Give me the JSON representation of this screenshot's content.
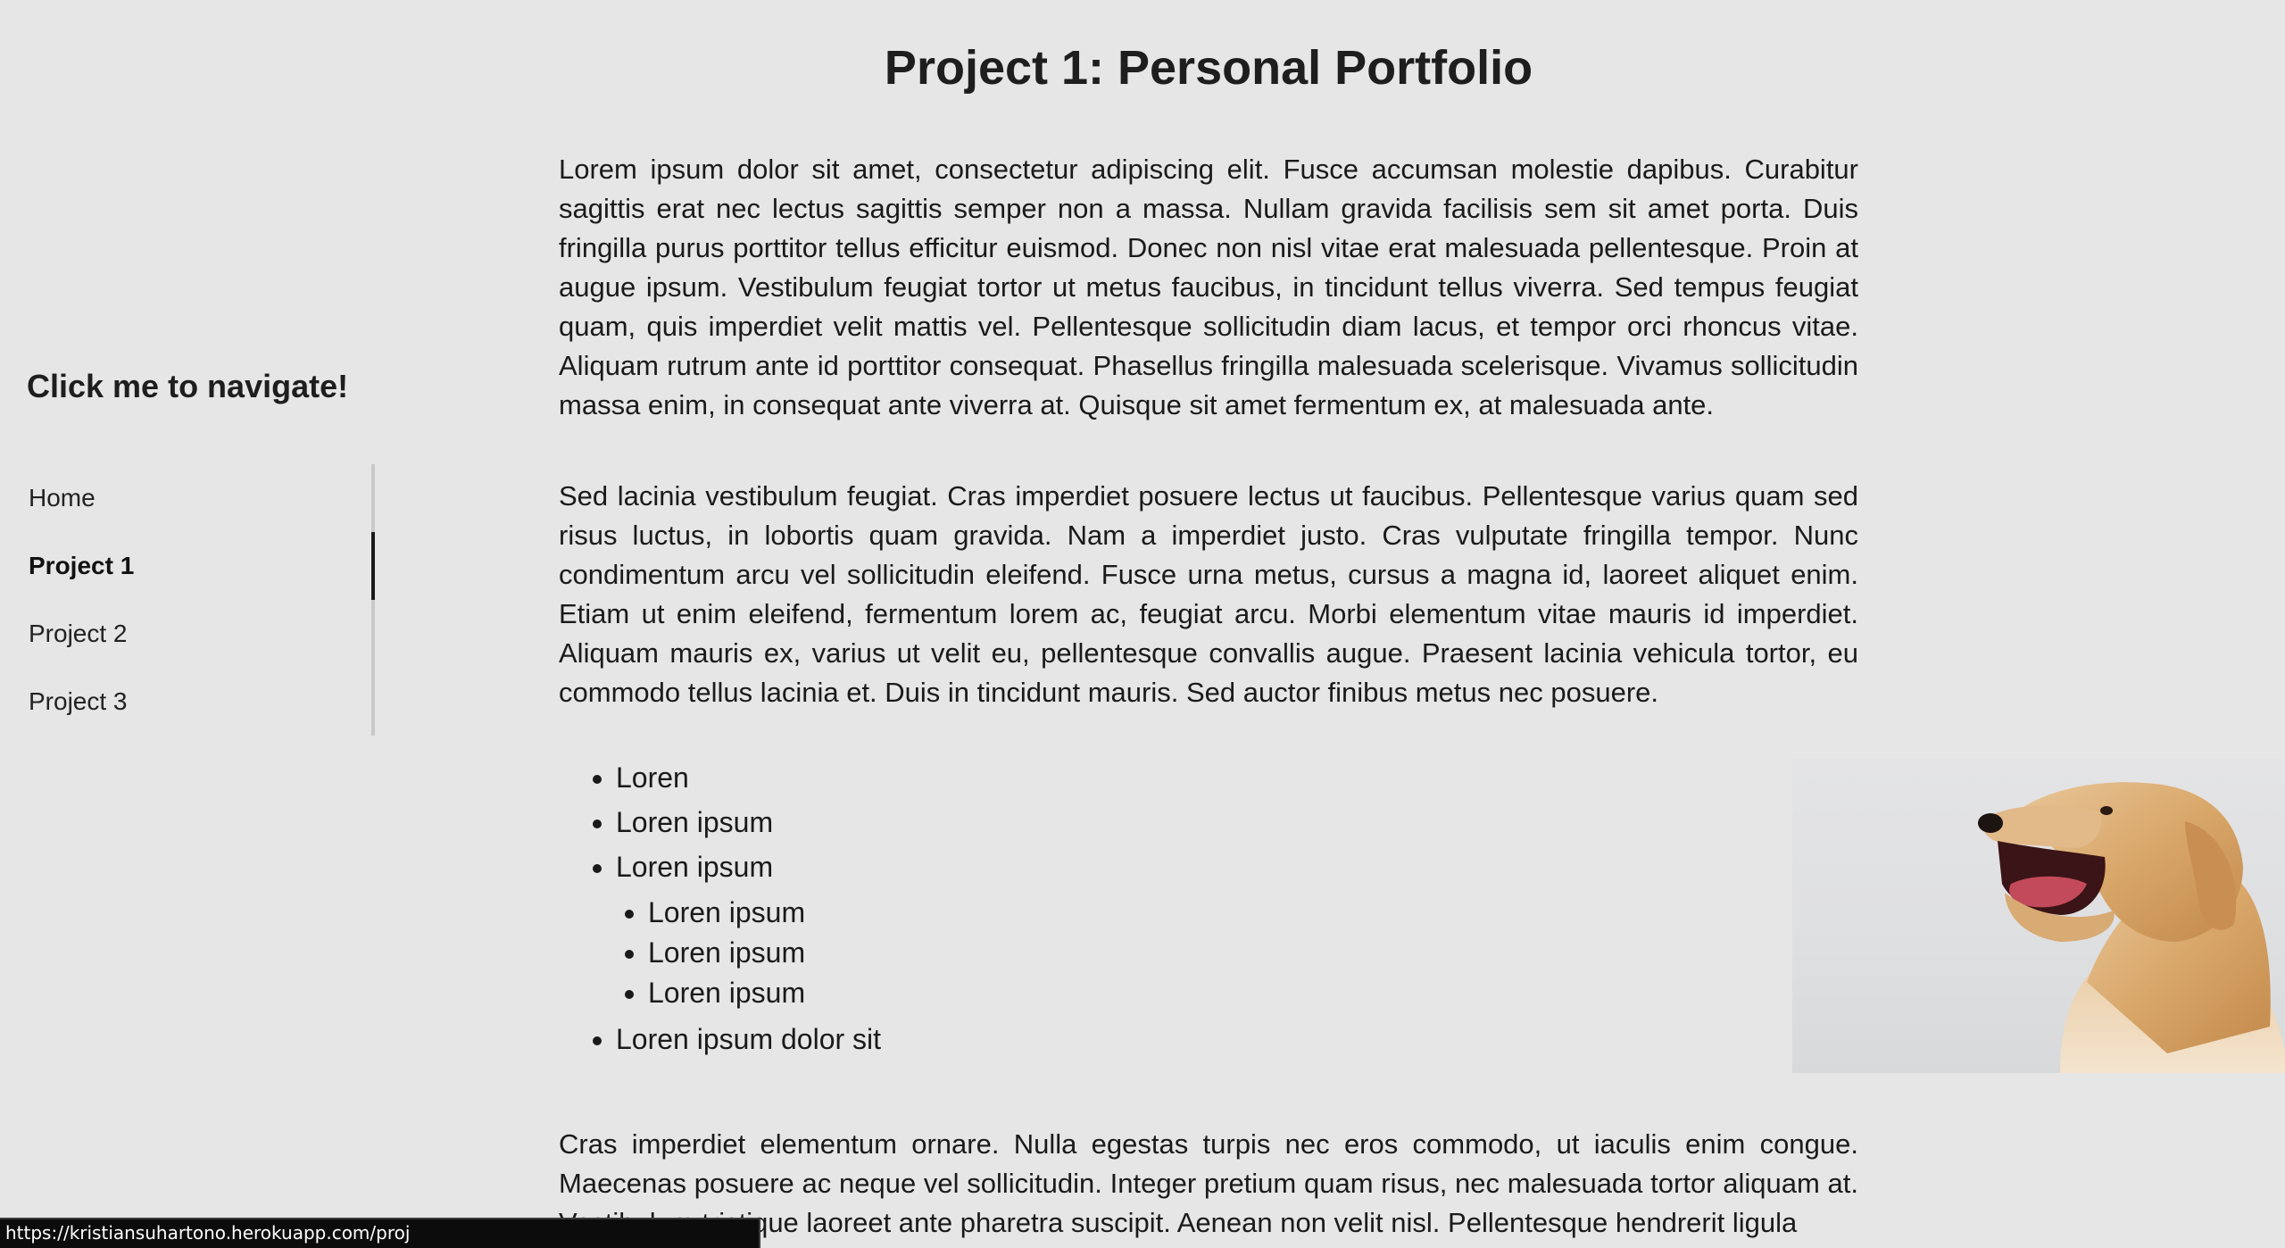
{
  "sidebar": {
    "title": "Click me to navigate!",
    "items": [
      {
        "label": "Home",
        "active": false
      },
      {
        "label": "Project 1",
        "active": true
      },
      {
        "label": "Project 2",
        "active": false
      },
      {
        "label": "Project 3",
        "active": false
      }
    ]
  },
  "main": {
    "title": "Project 1: Personal Portfolio",
    "paragraphs": [
      "Lorem ipsum dolor sit amet, consectetur adipiscing elit. Fusce accumsan molestie dapibus. Curabitur sagittis erat nec lectus sagittis semper non a massa. Nullam gravida facilisis sem sit amet porta. Duis fringilla purus porttitor tellus efficitur euismod. Donec non nisl vitae erat malesuada pellentesque. Proin at augue ipsum. Vestibulum feugiat tortor ut metus faucibus, in tincidunt tellus viverra. Sed tempus feugiat quam, quis imperdiet velit mattis vel. Pellentesque sollicitudin diam lacus, et tempor orci rhoncus vitae. Aliquam rutrum ante id porttitor consequat. Phasellus fringilla malesuada scelerisque. Vivamus sollicitudin massa enim, in consequat ante viverra at. Quisque sit amet fermentum ex, at malesuada ante.",
      "Sed lacinia vestibulum feugiat. Cras imperdiet posuere lectus ut faucibus. Pellentesque varius quam sed risus luctus, in lobortis quam gravida. Nam a imperdiet justo. Cras vulputate fringilla tempor. Nunc condimentum arcu vel sollicitudin eleifend. Fusce urna metus, cursus a magna id, laoreet aliquet enim. Etiam ut enim eleifend, fermentum lorem ac, feugiat arcu. Morbi elementum vitae mauris id imperdiet. Aliquam mauris ex, varius ut velit eu, pellentesque convallis augue. Praesent lacinia vehicula tortor, eu commodo tellus lacinia et. Duis in tincidunt mauris. Sed auctor finibus metus nec posuere.",
      "Cras imperdiet elementum ornare. Nulla egestas turpis nec eros commodo, ut iaculis enim congue. Maecenas posuere ac neque vel sollicitudin. Integer pretium quam risus, nec malesuada tortor aliquam at. Vestibulum tristique laoreet ante pharetra suscipit. Aenean non velit nisl. Pellentesque hendrerit ligula"
    ],
    "list": {
      "items": [
        "Loren",
        "Loren ipsum",
        "Loren ipsum"
      ],
      "subitems": [
        "Loren ipsum",
        "Loren ipsum",
        "Loren ipsum"
      ],
      "last_item": "Loren ipsum dolor sit"
    }
  },
  "status_bar": {
    "url": "https://kristiansuhartono.herokuapp.com/proj"
  }
}
